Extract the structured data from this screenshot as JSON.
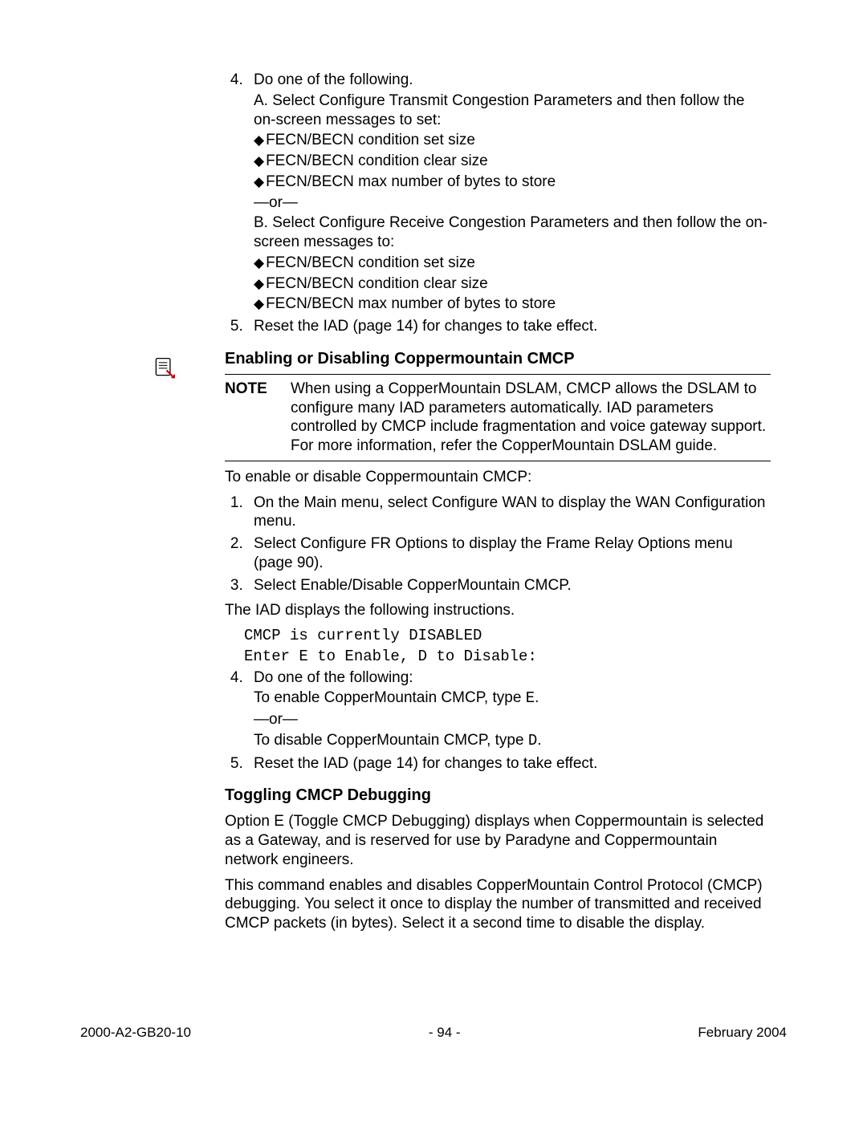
{
  "list1": {
    "start": 4,
    "items": [
      {
        "text": "Do one of the following.",
        "subA_intro": "A. Select Configure Transmit Congestion Parameters and then follow the on-screen messages to set:",
        "subA": [
          "FECN/BECN condition set size",
          "FECN/BECN condition clear size",
          "FECN/BECN max number of bytes to store"
        ],
        "or": "—or—",
        "subB_intro": "B. Select Configure Receive Congestion Parameters and then follow the on-screen messages to:",
        "subB": [
          "FECN/BECN condition set size",
          "FECN/BECN condition clear size",
          "FECN/BECN max number of bytes to store"
        ]
      },
      {
        "text": "Reset the IAD (page 14) for changes to take effect."
      }
    ]
  },
  "section1": {
    "title": "Enabling or Disabling Coppermountain CMCP",
    "noteLabel": "NOTE",
    "noteText": "When using a CopperMountain DSLAM, CMCP allows the DSLAM to configure many IAD parameters automatically. IAD parameters controlled by CMCP include fragmentation and voice gateway support. For more information, refer the CopperMountain DSLAM guide.",
    "intro": "To enable or disable Coppermountain CMCP:",
    "steps": [
      "On the Main menu, select Configure WAN to display the WAN Configuration menu.",
      "Select Configure FR Options to display the Frame Relay Options menu (page 90).",
      "Select Enable/Disable CopperMountain CMCP."
    ],
    "afterSteps": "The IAD displays the following instructions.",
    "code1": "CMCP is currently DISABLED",
    "code2": "Enter E to Enable, D to Disable:",
    "steps2_start": 4,
    "steps2": [
      {
        "text": "Do one of the following:",
        "lineA_pre": "To enable CopperMountain CMCP, type ",
        "lineA_code": "E",
        "lineA_post": ".",
        "or": "—or—",
        "lineB_pre": "To disable CopperMountain CMCP, type ",
        "lineB_code": "D",
        "lineB_post": "."
      },
      {
        "text": "Reset the IAD (page 14) for changes to take effect."
      }
    ]
  },
  "section2": {
    "title": "Toggling CMCP Debugging",
    "p1": "Option E (Toggle CMCP Debugging) displays when Coppermountain is selected as a Gateway, and is reserved for use by Paradyne and Coppermountain network engineers.",
    "p2": "This command enables and disables CopperMountain Control Protocol (CMCP) debugging. You select it once to display the number of transmitted and received CMCP packets (in bytes). Select it a second time to disable the display."
  },
  "footer": {
    "left": "2000-A2-GB20-10",
    "center": "- 94 -",
    "right": "February 2004"
  }
}
